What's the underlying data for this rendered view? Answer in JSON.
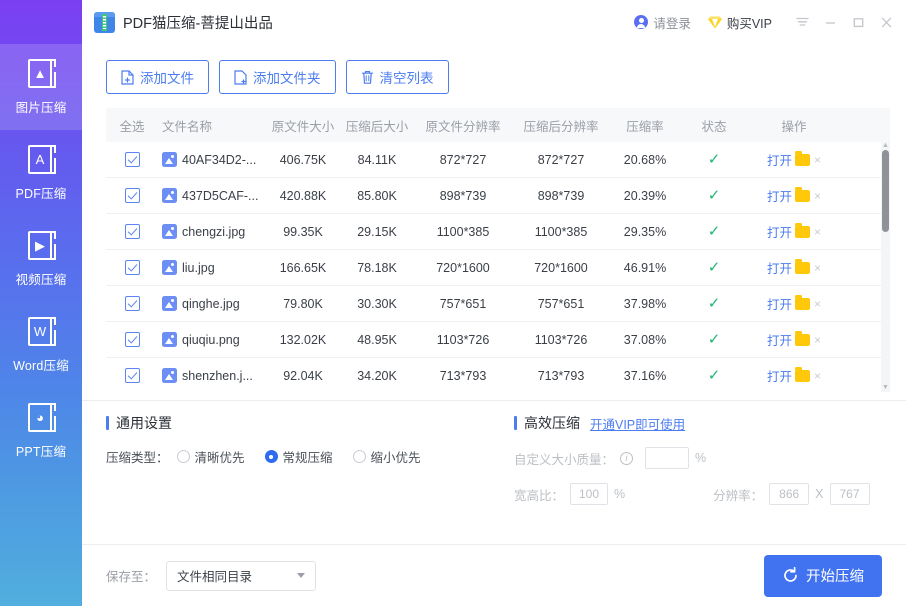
{
  "window": {
    "title": "PDF猫压缩-菩提山出品",
    "app_icon": "zip-folder-icon",
    "login_label": "请登录",
    "vip_label": "购买VIP",
    "controls": {
      "menu": "menu-icon",
      "minimize": "minimize-icon",
      "maximize": "maximize-icon",
      "close": "close-icon"
    }
  },
  "sidebar": {
    "items": [
      {
        "label": "图片压缩",
        "icon": "image-doc-icon",
        "glyph": "▲",
        "active": true
      },
      {
        "label": "PDF压缩",
        "icon": "pdf-doc-icon",
        "glyph": "A",
        "active": false
      },
      {
        "label": "视频压缩",
        "icon": "video-doc-icon",
        "glyph": "▶",
        "active": false
      },
      {
        "label": "Word压缩",
        "icon": "word-doc-icon",
        "glyph": "W",
        "active": false
      },
      {
        "label": "PPT压缩",
        "icon": "ppt-doc-icon",
        "glyph": "◕",
        "active": false
      }
    ]
  },
  "toolbar": {
    "add_file": "添加文件",
    "add_folder": "添加文件夹",
    "clear_list": "清空列表"
  },
  "table": {
    "headers": [
      "全选",
      "文件名称",
      "原文件大小",
      "压缩后大小",
      "原文件分辨率",
      "压缩后分辨率",
      "压缩率",
      "状态",
      "操作"
    ],
    "open_label": "打开",
    "delete_label": "×",
    "rows": [
      {
        "checked": true,
        "name": "40AF34D2-...",
        "original_size": "406.75K",
        "compressed_size": "84.11K",
        "original_res": "872*727",
        "compressed_res": "872*727",
        "rate": "20.68%",
        "status": "done"
      },
      {
        "checked": true,
        "name": "437D5CAF-...",
        "original_size": "420.88K",
        "compressed_size": "85.80K",
        "original_res": "898*739",
        "compressed_res": "898*739",
        "rate": "20.39%",
        "status": "done"
      },
      {
        "checked": true,
        "name": "chengzi.jpg",
        "original_size": "99.35K",
        "compressed_size": "29.15K",
        "original_res": "1100*385",
        "compressed_res": "1100*385",
        "rate": "29.35%",
        "status": "done"
      },
      {
        "checked": true,
        "name": "liu.jpg",
        "original_size": "166.65K",
        "compressed_size": "78.18K",
        "original_res": "720*1600",
        "compressed_res": "720*1600",
        "rate": "46.91%",
        "status": "done"
      },
      {
        "checked": true,
        "name": "qinghe.jpg",
        "original_size": "79.80K",
        "compressed_size": "30.30K",
        "original_res": "757*651",
        "compressed_res": "757*651",
        "rate": "37.98%",
        "status": "done"
      },
      {
        "checked": true,
        "name": "qiuqiu.png",
        "original_size": "132.02K",
        "compressed_size": "48.95K",
        "original_res": "1103*726",
        "compressed_res": "1103*726",
        "rate": "37.08%",
        "status": "done"
      },
      {
        "checked": true,
        "name": "shenzhen.j...",
        "original_size": "92.04K",
        "compressed_size": "34.20K",
        "original_res": "713*793",
        "compressed_res": "713*793",
        "rate": "37.16%",
        "status": "done"
      }
    ]
  },
  "general_settings": {
    "title": "通用设置",
    "compress_type_label": "压缩类型：",
    "options": [
      {
        "label": "清晰优先",
        "selected": false
      },
      {
        "label": "常规压缩",
        "selected": true
      },
      {
        "label": "缩小优先",
        "selected": false
      }
    ]
  },
  "efficient_settings": {
    "title": "高效压缩",
    "vip_link": "开通VIP即可使用",
    "quality_label": "自定义大小质量：",
    "quality_value": "",
    "percent": "%",
    "ratio_label": "宽高比：",
    "ratio_value": "100",
    "ratio_percent": "%",
    "resolution_label": "分辨率：",
    "res_width": "866",
    "res_x": "X",
    "res_height": "767"
  },
  "bottom": {
    "save_label": "保存至：",
    "save_path": "文件相同目录",
    "start_label": "开始压缩",
    "start_icon": "refresh-icon"
  },
  "colors": {
    "accent": "#4c7df0",
    "primary_button": "#4172ef",
    "success": "#22b573",
    "folder": "#ffc808",
    "vip": "#ffd21e",
    "sidebar_top": "#7b3ff2",
    "sidebar_bottom": "#51aede"
  }
}
